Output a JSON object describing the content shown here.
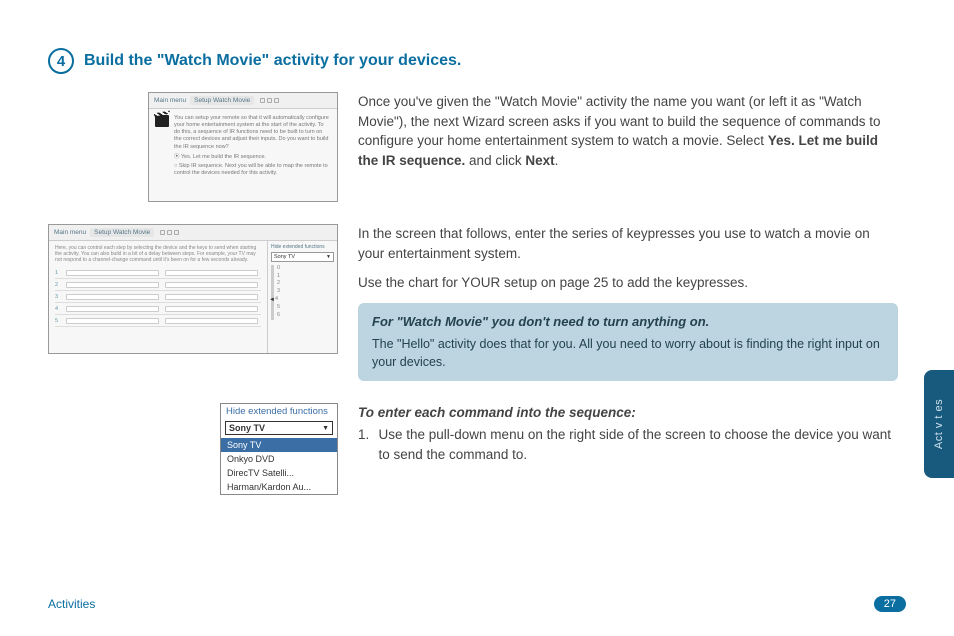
{
  "step": {
    "number": "4",
    "title": "Build the \"Watch Movie\" activity for your devices."
  },
  "section1": {
    "paragraph": "Once you've given the \"Watch Movie\" activity the name you want (or left it as \"Watch Movie\"), the next Wizard screen asks if you want to build the sequence of commands to configure your home entertainment system to watch a movie. Select ",
    "bold1": "Yes. Let me build the IR sequence.",
    "mid": " and click ",
    "bold2": "Next",
    "tail": ".",
    "thumb": {
      "crumb1": "Main menu",
      "crumb2": "Setup Watch Movie",
      "body": "You can setup your remote so that it will automatically configure your home entertainment system at the start of the activity. To do this, a sequence of IR functions need to be built to turn on the correct devices and adjust their inputs. Do you want to build the IR sequence now?",
      "opt1": "Yes. Let me build the IR sequence.",
      "opt2": "Skip IR sequence. Next you will be able to map the remote to control the devices needed for this activity."
    }
  },
  "section2": {
    "para1": "In the screen that follows, enter the series of keypresses you use to watch a movie on your entertainment system.",
    "para2": "Use the chart for YOUR setup on page 25 to add the keypresses.",
    "callout_title": "For \"Watch Movie\" you don't need to turn anything on.",
    "callout_body": "The \"Hello\" activity does that for you. All you need to worry about is finding the right input on your devices.",
    "thumb": {
      "crumb1": "Main menu",
      "crumb2": "Setup Watch Movie",
      "desc": "Here, you can control each step by selecting the device and the keys to send when starting the activity. You can also build in a bit of a delay between steps. For example, your TV may not respond to a channel-change command until it's been on for a few seconds already.",
      "side_label": "Hide extended functions",
      "selected": "Sony TV",
      "nums": [
        "0",
        "1",
        "2",
        "3",
        "4",
        "5",
        "6"
      ]
    }
  },
  "section3": {
    "subhead": "To enter each command into the sequence:",
    "num": "1.",
    "text": "Use the pull-down menu on the right side of the screen to choose the device you want to send the command to.",
    "thumb": {
      "hdr": "Hide extended functions",
      "selected": "Sony TV",
      "options": [
        "Sony TV",
        "Onkyo DVD",
        "DirecTV Satelli...",
        "Harman/Kardon Au..."
      ]
    }
  },
  "sidetab": "Act v t es",
  "footer": {
    "section": "Activities",
    "page": "27"
  }
}
